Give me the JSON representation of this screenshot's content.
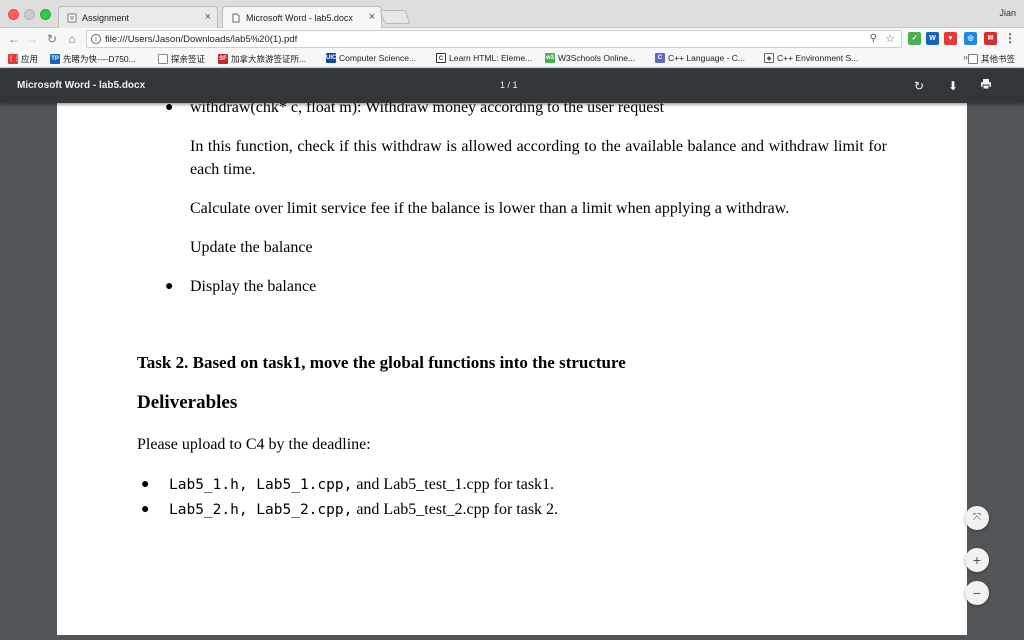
{
  "browser": {
    "profile_name": "Jian",
    "tabs": [
      {
        "label": "Assignment"
      },
      {
        "label": "Microsoft Word - lab5.docx"
      }
    ],
    "url": "file:///Users/Jason/Downloads/lab5%20(1).pdf"
  },
  "bookmarks": {
    "items": [
      {
        "label": "应用"
      },
      {
        "label": "先睹为快----D750..."
      },
      {
        "label": "探亲签证"
      },
      {
        "label": "加拿大旅游签证所..."
      },
      {
        "label": "Computer Science..."
      },
      {
        "label": "Learn HTML: Eleme..."
      },
      {
        "label": "W3Schools Online..."
      },
      {
        "label": "C++ Language - C..."
      },
      {
        "label": "C++ Environment S..."
      }
    ],
    "more_label": "»",
    "other_label": "其他书签"
  },
  "pdf": {
    "title": "Microsoft Word - lab5.docx",
    "page_indicator": "1 / 1"
  },
  "document": {
    "withdraw_item": "withdraw(chk* c, float m): Withdraw money according to the user request",
    "para1": "In this function, check if this withdraw is allowed according to the available balance and withdraw limit for each time.",
    "para2": "Calculate over limit service fee if the balance is lower than a limit when applying a withdraw.",
    "para3": "Update the balance",
    "display_item": "Display the balance",
    "task2": "Task 2. Based on task1, move the global functions into the structure",
    "deliverables": "Deliverables",
    "upload": "Please upload to C4 by the deadline:",
    "list": [
      {
        "code": "Lab5_1.h, Lab5_1.cpp,",
        "text": " and Lab5_test_1.cpp for task1."
      },
      {
        "code": "Lab5_2.h, Lab5_2.cpp,",
        "text": " and Lab5_test_2.cpp for task 2."
      }
    ]
  }
}
